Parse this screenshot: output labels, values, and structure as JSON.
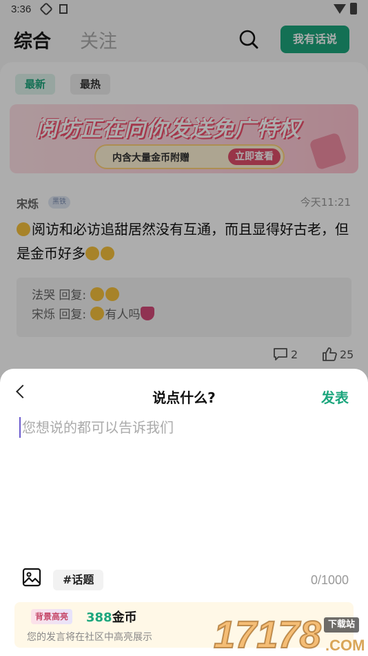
{
  "status_bar": {
    "time": "3:36"
  },
  "header": {
    "tabs": [
      {
        "label": "综合"
      },
      {
        "label": "关注"
      }
    ],
    "post_button": "我有话说"
  },
  "feed": {
    "filters": [
      {
        "label": "最新"
      },
      {
        "label": "最热"
      }
    ],
    "banner": {
      "headline": "阅坊正在向你发送免广特权",
      "subtext": "内含大量金币附赠",
      "cta": "立即查看"
    },
    "post": {
      "username": "宋烁",
      "level_badge": "黑铁",
      "time": "今天11:21",
      "content": "阅访和必访追甜居然没有互通，而且显得好古老，但是金币好多",
      "replies": [
        {
          "user": "法哭",
          "sep": " 回复: ",
          "text": ""
        },
        {
          "user": "宋烁",
          "sep": " 回复: ",
          "text": "有人吗"
        }
      ],
      "comments": "2",
      "likes": "25"
    }
  },
  "sheet": {
    "title": "说点什么?",
    "publish": "发表",
    "placeholder": "您想说的都可以告诉我们",
    "topic_button": "#话题",
    "char_count": "0/1000",
    "promo": {
      "badge": "背景高亮",
      "amount": "388",
      "unit": "金币",
      "desc": "您的发言将在社区中高亮展示"
    }
  },
  "watermark": {
    "numbers": "17178",
    "tag": "下载站",
    "domain": ".COM"
  },
  "colors": {
    "accent": "#1ca67d",
    "cursor": "#6a5acd"
  }
}
